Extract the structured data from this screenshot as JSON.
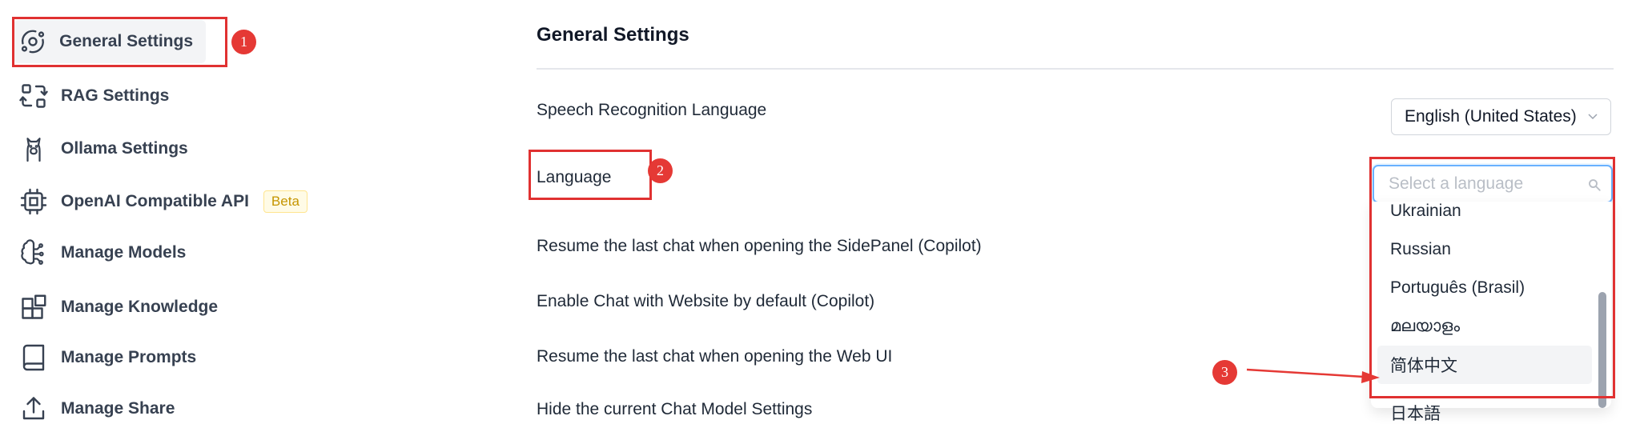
{
  "sidebar": {
    "items": [
      {
        "label": "General Settings",
        "icon": "orbit-icon",
        "active": true
      },
      {
        "label": "RAG Settings",
        "icon": "rag-transfer-icon"
      },
      {
        "label": "Ollama Settings",
        "icon": "llama-icon"
      },
      {
        "label": "OpenAI Compatible API",
        "icon": "cpu-icon",
        "badge": "Beta"
      },
      {
        "label": "Manage Models",
        "icon": "brain-icon"
      },
      {
        "label": "Manage Knowledge",
        "icon": "blocks-icon"
      },
      {
        "label": "Manage Prompts",
        "icon": "book-icon"
      },
      {
        "label": "Manage Share",
        "icon": "share-icon"
      }
    ]
  },
  "main": {
    "title": "General Settings",
    "settings": [
      {
        "label": "Speech Recognition Language",
        "value": "English (United States)"
      },
      {
        "label": "Language",
        "placeholder": "Select a language"
      },
      {
        "label": "Resume the last chat when opening the SidePanel (Copilot)"
      },
      {
        "label": "Enable Chat with Website by default (Copilot)"
      },
      {
        "label": "Resume the last chat when opening the Web UI"
      },
      {
        "label": "Hide the current Chat Model Settings"
      }
    ],
    "language_options": [
      "Ukrainian",
      "Russian",
      "Português (Brasil)",
      "മലയാളം",
      "简体中文",
      "日本語"
    ]
  },
  "annotations": {
    "markers": [
      "1",
      "2",
      "3"
    ],
    "color": "#e53935"
  },
  "colors": {
    "focus_border": "#69b1ff",
    "highlight_bg": "#f3f4f6",
    "beta_text": "#c59500"
  }
}
